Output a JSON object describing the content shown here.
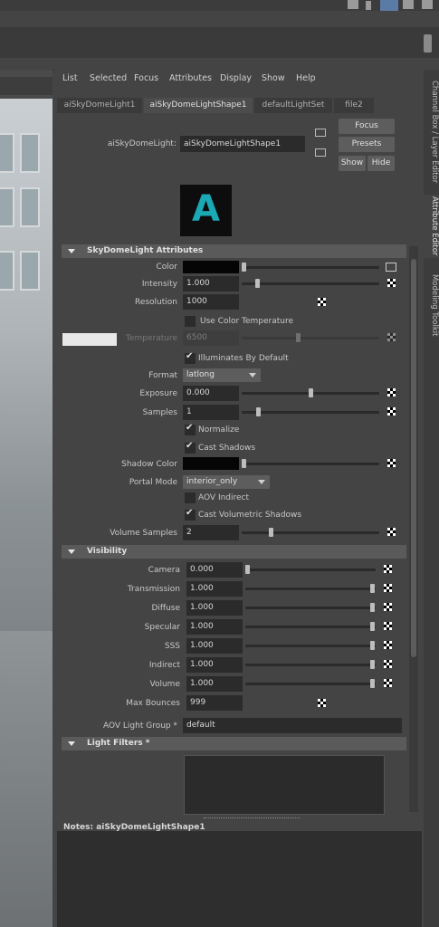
{
  "menu": [
    "List",
    "Selected",
    "Focus",
    "Attributes",
    "Display",
    "Show",
    "Help"
  ],
  "tabs": [
    "aiSkyDomeLight1",
    "aiSkyDomeLightShape1",
    "defaultLightSet",
    "file2"
  ],
  "node": {
    "label": "aiSkyDomeLight:",
    "value": "aiSkyDomeLightShape1"
  },
  "buttons": {
    "focus": "Focus",
    "presets": "Presets",
    "show": "Show",
    "hide": "Hide"
  },
  "logo_letter": "A",
  "sections": {
    "skydome": "SkyDomeLight Attributes",
    "visibility": "Visibility",
    "light_filters": "Light Filters *"
  },
  "skydome": {
    "color_label": "Color",
    "intensity_label": "Intensity",
    "intensity": "1.000",
    "resolution_label": "Resolution",
    "resolution": "1000",
    "use_color_temp": "Use Color Temperature",
    "temperature_label": "Temperature",
    "temperature": "6500",
    "illuminates": "Illuminates By Default",
    "format_label": "Format",
    "format": "latlong",
    "exposure_label": "Exposure",
    "exposure": "0.000",
    "samples_label": "Samples",
    "samples": "1",
    "normalize": "Normalize",
    "cast_shadows": "Cast Shadows",
    "shadow_color_label": "Shadow Color",
    "portal_mode_label": "Portal Mode",
    "portal_mode": "interior_only",
    "aov_indirect": "AOV Indirect",
    "cast_volumetric": "Cast Volumetric Shadows",
    "volume_samples_label": "Volume Samples",
    "volume_samples": "2"
  },
  "visibility": {
    "rows": [
      {
        "label": "Camera",
        "value": "0.000"
      },
      {
        "label": "Transmission",
        "value": "1.000"
      },
      {
        "label": "Diffuse",
        "value": "1.000"
      },
      {
        "label": "Specular",
        "value": "1.000"
      },
      {
        "label": "SSS",
        "value": "1.000"
      },
      {
        "label": "Indirect",
        "value": "1.000"
      },
      {
        "label": "Volume",
        "value": "1.000"
      }
    ],
    "max_bounces_label": "Max Bounces",
    "max_bounces": "999",
    "aov_group_label": "AOV Light Group *",
    "aov_group": "default"
  },
  "notes_label": "Notes:  aiSkyDomeLightShape1",
  "vertical_tabs": [
    "Channel Box / Layer Editor",
    "Attribute Editor",
    "Modeling Toolkit"
  ],
  "colors": {
    "accent": "#1aa9b5",
    "panel": "#444444",
    "field": "#2b2b2b"
  }
}
